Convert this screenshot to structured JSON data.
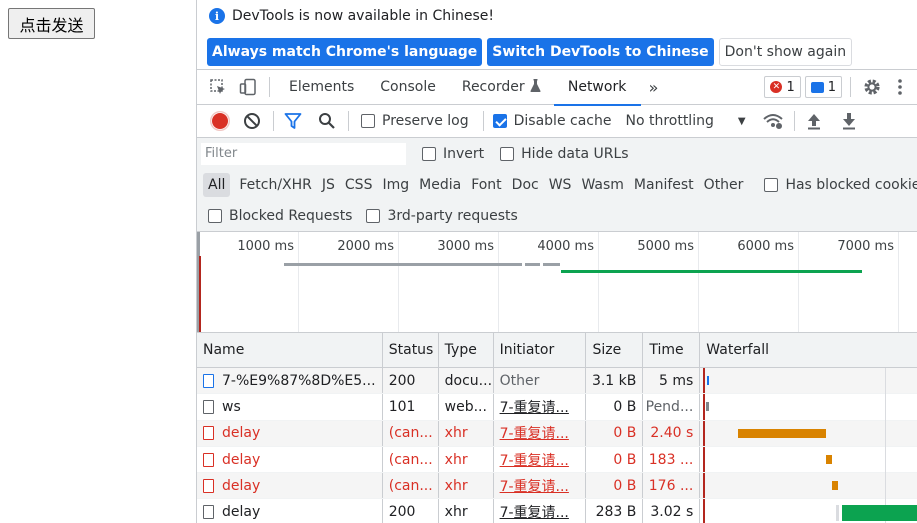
{
  "page": {
    "button_label": "点击发送"
  },
  "infobar": {
    "message": "DevTools is now available in Chinese!",
    "btn_match": "Always match Chrome's language",
    "btn_switch": "Switch DevTools to Chinese",
    "btn_dont": "Don't show again"
  },
  "tabs": {
    "elements": "Elements",
    "console": "Console",
    "recorder": "Recorder",
    "network": "Network",
    "more": "»",
    "errors": "1",
    "messages": "1"
  },
  "toolbar": {
    "preserve_log": "Preserve log",
    "disable_cache": "Disable cache",
    "throttling": "No throttling"
  },
  "filter": {
    "placeholder": "Filter",
    "invert": "Invert",
    "hide_data": "Hide data URLs",
    "types": [
      "All",
      "Fetch/XHR",
      "JS",
      "CSS",
      "Img",
      "Media",
      "Font",
      "Doc",
      "WS",
      "Wasm",
      "Manifest",
      "Other"
    ],
    "has_blocked": "Has blocked cookies",
    "blocked_requests": "Blocked Requests",
    "third_party": "3rd-party requests"
  },
  "overview": {
    "labels": [
      "1000 ms",
      "2000 ms",
      "3000 ms",
      "4000 ms",
      "5000 ms",
      "6000 ms",
      "7000 ms"
    ]
  },
  "table": {
    "headers": {
      "name": "Name",
      "status": "Status",
      "type": "Type",
      "initiator": "Initiator",
      "size": "Size",
      "time": "Time",
      "waterfall": "Waterfall"
    },
    "rows": [
      {
        "name": "7-%E9%87%8D%E5...",
        "status": "200",
        "type": "docu...",
        "initiator": "Other",
        "size": "3.1 kB",
        "time": "5 ms"
      },
      {
        "name": "ws",
        "status": "101",
        "type": "web...",
        "initiator": "7-重复请...",
        "size": "0 B",
        "time": "Pend..."
      },
      {
        "name": "delay",
        "status": "(can...",
        "type": "xhr",
        "initiator": "7-重复请...",
        "size": "0 B",
        "time": "2.40 s"
      },
      {
        "name": "delay",
        "status": "(can...",
        "type": "xhr",
        "initiator": "7-重复请...",
        "size": "0 B",
        "time": "183 ..."
      },
      {
        "name": "delay",
        "status": "(can...",
        "type": "xhr",
        "initiator": "7-重复请...",
        "size": "0 B",
        "time": "176 ..."
      },
      {
        "name": "delay",
        "status": "200",
        "type": "xhr",
        "initiator": "7-重复请...",
        "size": "283 B",
        "time": "3.02 s"
      }
    ]
  },
  "colors": {
    "accent": "#1a73e8",
    "error": "#d93025",
    "waiting": "#d98300",
    "success": "#0ca350"
  }
}
